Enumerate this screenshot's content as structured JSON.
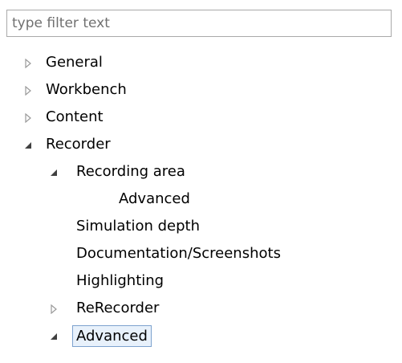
{
  "filter": {
    "placeholder": "type filter text",
    "value": ""
  },
  "tree": {
    "general": {
      "label": "General",
      "state": "collapsed"
    },
    "workbench": {
      "label": "Workbench",
      "state": "collapsed"
    },
    "content": {
      "label": "Content",
      "state": "collapsed"
    },
    "recorder": {
      "label": "Recorder",
      "state": "expanded",
      "recording_area": {
        "label": "Recording area",
        "state": "expanded",
        "advanced": {
          "label": "Advanced"
        }
      },
      "simulation_depth": {
        "label": "Simulation depth"
      },
      "documentation": {
        "label": "Documentation/Screenshots"
      },
      "highlighting": {
        "label": "Highlighting"
      },
      "rerecorder": {
        "label": "ReRecorder",
        "state": "collapsed"
      },
      "advanced": {
        "label": "Advanced",
        "state": "expanded",
        "selected": true
      }
    }
  },
  "colors": {
    "collapsed_arrow": "#9a9a9a",
    "expanded_arrow": "#404040",
    "selection_border": "#7da2ce",
    "selection_fill": "#e8f1fb",
    "input_border": "#a9a9a9",
    "placeholder_text": "#707070"
  },
  "icons": {
    "collapsed": "triangle-right-outline-icon",
    "expanded": "triangle-down-right-filled-icon"
  }
}
